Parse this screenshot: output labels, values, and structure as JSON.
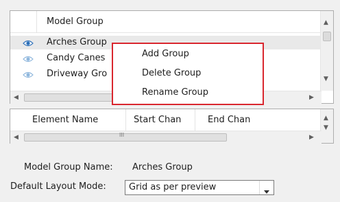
{
  "groups_table": {
    "header": "Model Group",
    "rows": [
      {
        "label": "Arches Group"
      },
      {
        "label": "Candy Canes"
      },
      {
        "label": "Driveway Gro"
      }
    ]
  },
  "context_menu": {
    "items": [
      "Add Group",
      "Delete Group",
      "Rename Group"
    ]
  },
  "elements_table": {
    "headers": [
      "Element Name",
      "Start Chan",
      "End Chan"
    ]
  },
  "form": {
    "model_group_name_label": "Model Group Name:",
    "model_group_name_value": "Arches Group",
    "layout_mode_label": "Default Layout Mode:",
    "layout_mode_value": "Grid as per preview"
  },
  "scrollbar_glyphs": {
    "up": "▲",
    "down": "▼",
    "left": "◀",
    "right": "▶",
    "grip": "III"
  },
  "colors": {
    "highlight_border": "#d9262e",
    "eye_active": "#2c6fb8",
    "eye_inactive": "#8fb7dd"
  }
}
